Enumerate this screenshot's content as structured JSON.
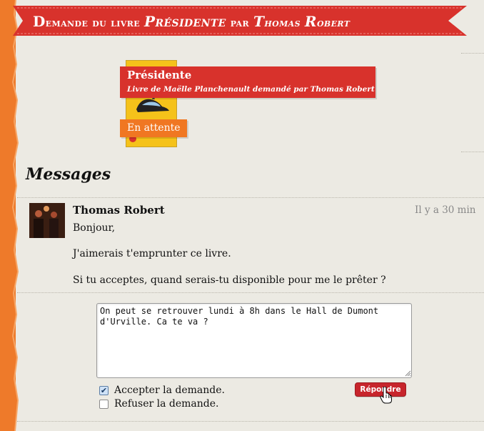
{
  "header": {
    "title_prefix_first": "D",
    "title_prefix_rest": "emande du livre ",
    "title_book": "Présidente",
    "title_mid": " par ",
    "title_user_first": "T",
    "title_user_rest": "homas ",
    "title_user2_first": "R",
    "title_user2_rest": "obert"
  },
  "book": {
    "title": "Présidente",
    "subtitle": "Livre de Maëlle Planchenault demandé par Thomas Robert",
    "status": "En attente"
  },
  "messages": {
    "section_title": "Messages",
    "items": [
      {
        "author": "Thomas Robert",
        "time": "Il y a 30 min",
        "lines": [
          "Bonjour,",
          "J'aimerais t'emprunter ce livre.",
          "Si tu acceptes, quand serais-tu disponible pour me le prêter ?"
        ]
      }
    ]
  },
  "reply": {
    "value": "On peut se retrouver lundi à 8h dans le Hall de Dumont d'Urville. Ca te va ?",
    "accept_label": "Accepter la demande.",
    "accept_checked": true,
    "refuse_label": "Refuser la demande.",
    "refuse_checked": false,
    "submit_label": "Répondre"
  },
  "colors": {
    "ribbon": "#d8322c",
    "status": "#f07722",
    "side_strip": "#ee7a2a"
  }
}
